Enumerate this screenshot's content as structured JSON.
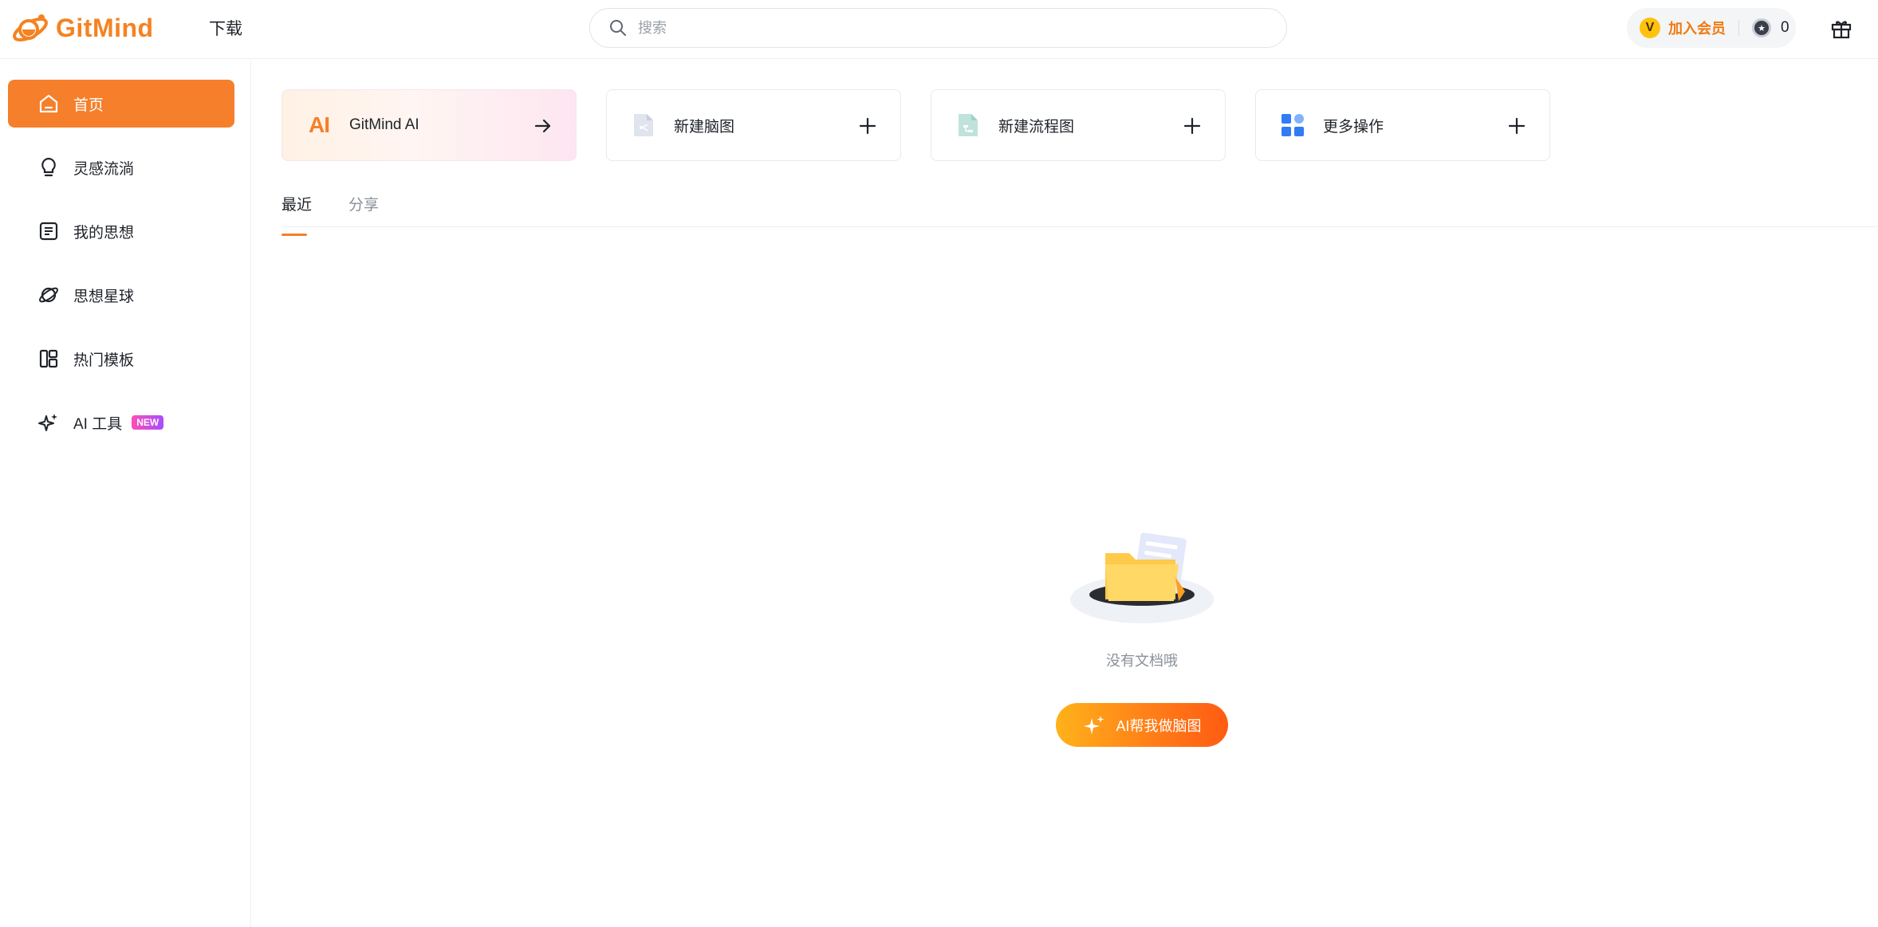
{
  "brand": {
    "name": "GitMind",
    "accent": "#f57f2b"
  },
  "header": {
    "download_label": "下载",
    "search_placeholder": "搜索",
    "vip_badge": "V",
    "vip_label": "加入会员",
    "coin_count": "0",
    "icons": [
      "search-icon",
      "vip-icon",
      "coin-icon",
      "gift-icon"
    ]
  },
  "sidebar": {
    "items": [
      {
        "label": "首页",
        "icon": "home-icon",
        "active": true
      },
      {
        "label": "灵感流淌",
        "icon": "lightbulb-icon"
      },
      {
        "label": "我的思想",
        "icon": "document-icon"
      },
      {
        "label": "思想星球",
        "icon": "planet-icon"
      },
      {
        "label": "热门模板",
        "icon": "template-icon"
      },
      {
        "label": "AI 工具",
        "icon": "sparkle-icon",
        "badge": "NEW"
      }
    ]
  },
  "cards": [
    {
      "mark": "AI",
      "label": "GitMind AI",
      "action": "arrow-right-icon"
    },
    {
      "label": "新建脑图",
      "icon": "mindmap-file-icon",
      "action": "plus-icon"
    },
    {
      "label": "新建流程图",
      "icon": "flowchart-file-icon",
      "action": "plus-icon"
    },
    {
      "label": "更多操作",
      "icon": "grid-icon",
      "action": "plus-icon"
    }
  ],
  "tabs": [
    {
      "label": "最近",
      "active": true
    },
    {
      "label": "分享",
      "active": false
    }
  ],
  "empty_state": {
    "message": "没有文档哦",
    "button_label": "AI帮我做脑图"
  }
}
